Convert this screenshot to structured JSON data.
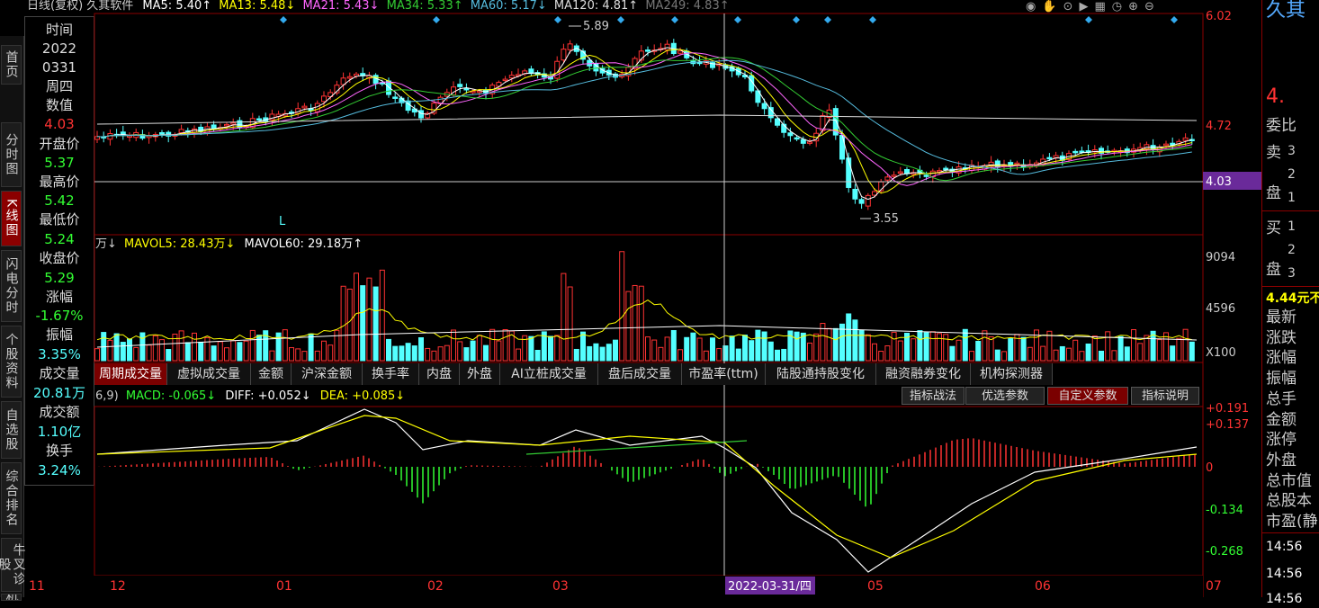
{
  "top_bar": {
    "title": "日线(复权) 久其软件",
    "ma5": "MA5: 5.40↑",
    "ma13": "MA13: 5.48↓",
    "ma21": "MA21: 5.43↓",
    "ma34": "MA34: 5.33↑",
    "ma60": "MA60: 5.17↓",
    "ma120": "MA120: 4.81↑",
    "ma249": "MA249: 4.83↑"
  },
  "toolbar_icons": [
    "eye-icon",
    "hand-icon",
    "record-icon",
    "play-icon",
    "grid-icon",
    "clock-icon",
    "zoom-in-icon",
    "zoom-out-icon"
  ],
  "nav": [
    "首页",
    "分时图",
    "K线图",
    "闪电分时",
    "个股资料",
    "自选股",
    "综合排名",
    "牛叉诊股",
    "机"
  ],
  "info_panel": {
    "time_label": "时间",
    "year": "2022",
    "date": "0331",
    "weekday": "周四",
    "value_label": "数值",
    "value": "4.03",
    "open_label": "开盘价",
    "open": "5.37",
    "high_label": "最高价",
    "high": "5.42",
    "low_label": "最低价",
    "low": "5.24",
    "close_label": "收盘价",
    "close": "5.29",
    "change_label": "涨幅",
    "change": "-1.67%",
    "amplitude_label": "振幅",
    "amplitude": "3.35%",
    "volume_label": "成交量",
    "volume": "20.81万",
    "amount_label": "成交额",
    "amount": "1.10亿",
    "turnover_label": "换手",
    "turnover": "3.24%"
  },
  "price_axis": {
    "top": "6.02",
    "mid": "4.72",
    "cursor": "4.03"
  },
  "price_annotations": {
    "high": "5.89",
    "low": "3.55",
    "marker": "L"
  },
  "volume_header": {
    "vol": "万↓",
    "mavol5": "MAVOL5: 28.43万↓",
    "mavol60": "MAVOL60: 29.18万↑"
  },
  "volume_axis": {
    "top": "9094",
    "mid": "4596",
    "unit": "X100"
  },
  "tabs": [
    "周期成交量",
    "虚拟成交量",
    "金额",
    "沪深金额",
    "换手率",
    "内盘",
    "外盘",
    "AI立桩成交量",
    "盘后成交量",
    "市盈率(ttm)",
    "陆股通持股变化",
    "融资融券变化",
    "机构探测器"
  ],
  "macd_header": {
    "params": "6,9)",
    "macd": "MACD: -0.065↓",
    "diff": "DIFF: +0.052↓",
    "dea": "DEA: +0.085↓"
  },
  "macd_buttons": [
    "指标战法",
    "优选参数",
    "自定义参数",
    "指标说明"
  ],
  "macd_axis": [
    "+0.191",
    "+0.137",
    "0",
    "-0.134",
    "-0.268"
  ],
  "date_axis": [
    "11",
    "12",
    "01",
    "02",
    "03",
    "2022-03-31/四",
    "05",
    "06",
    "07"
  ],
  "right_panel": {
    "brand": "久其",
    "price": "4.",
    "weibi": "委比",
    "sell": "卖",
    "sell_levels": [
      "3",
      "2",
      "1"
    ],
    "pan": "盘",
    "buy": "买",
    "buy_levels": [
      "1",
      "2",
      "3"
    ],
    "quote": "4.44元不",
    "fields": [
      "最新",
      "涨跌",
      "涨幅",
      "振幅",
      "总手",
      "金额",
      "涨停",
      "外盘",
      "总市值",
      "总股本",
      "市盈(静"
    ],
    "times": [
      "14:56",
      "14:56",
      "14:56"
    ]
  },
  "colors": {
    "up": "#ff3333",
    "down": "#54ffff",
    "ma5": "#ffffff",
    "ma13": "#ffff00",
    "ma21": "#ff66ff",
    "ma34": "#33cc33",
    "ma60": "#55bbdd",
    "accent": "#8b0000"
  }
}
